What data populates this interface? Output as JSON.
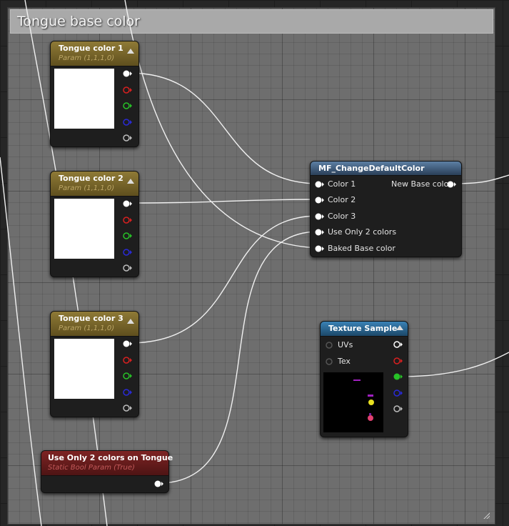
{
  "comment": {
    "title": "Tongue base color"
  },
  "colors": {
    "wire": "#f0f0f0",
    "pin_white": "#ffffff",
    "pin_red": "#d82020",
    "pin_green": "#27c227",
    "pin_blue": "#2a2ad6",
    "pin_alpha": "#bdbdbd",
    "param_header": "#8f7a36",
    "bool_header": "#7e2424",
    "function_header": "#5c7fa4",
    "texture_header": "#3a82b6"
  },
  "nodes": {
    "tongue_color_1": {
      "title": "Tongue color 1",
      "subtitle": "Param (1,1,1,0)"
    },
    "tongue_color_2": {
      "title": "Tongue color 2",
      "subtitle": "Param (1,1,1,0)"
    },
    "tongue_color_3": {
      "title": "Tongue color 3",
      "subtitle": "Param (1,1,1,0)"
    },
    "use_only_2": {
      "title": "Use Only 2 colors on Tongue",
      "subtitle": "Static Bool Param (True)"
    },
    "mf_change": {
      "title": "MF_ChangeDefaultColor",
      "inputs": [
        "Color 1",
        "Color 2",
        "Color 3",
        "Use Only 2 colors",
        "Baked Base color"
      ],
      "output": "New Base color"
    },
    "texture_sample": {
      "title": "Texture Sample",
      "inputs": [
        "UVs",
        "Tex"
      ]
    }
  }
}
